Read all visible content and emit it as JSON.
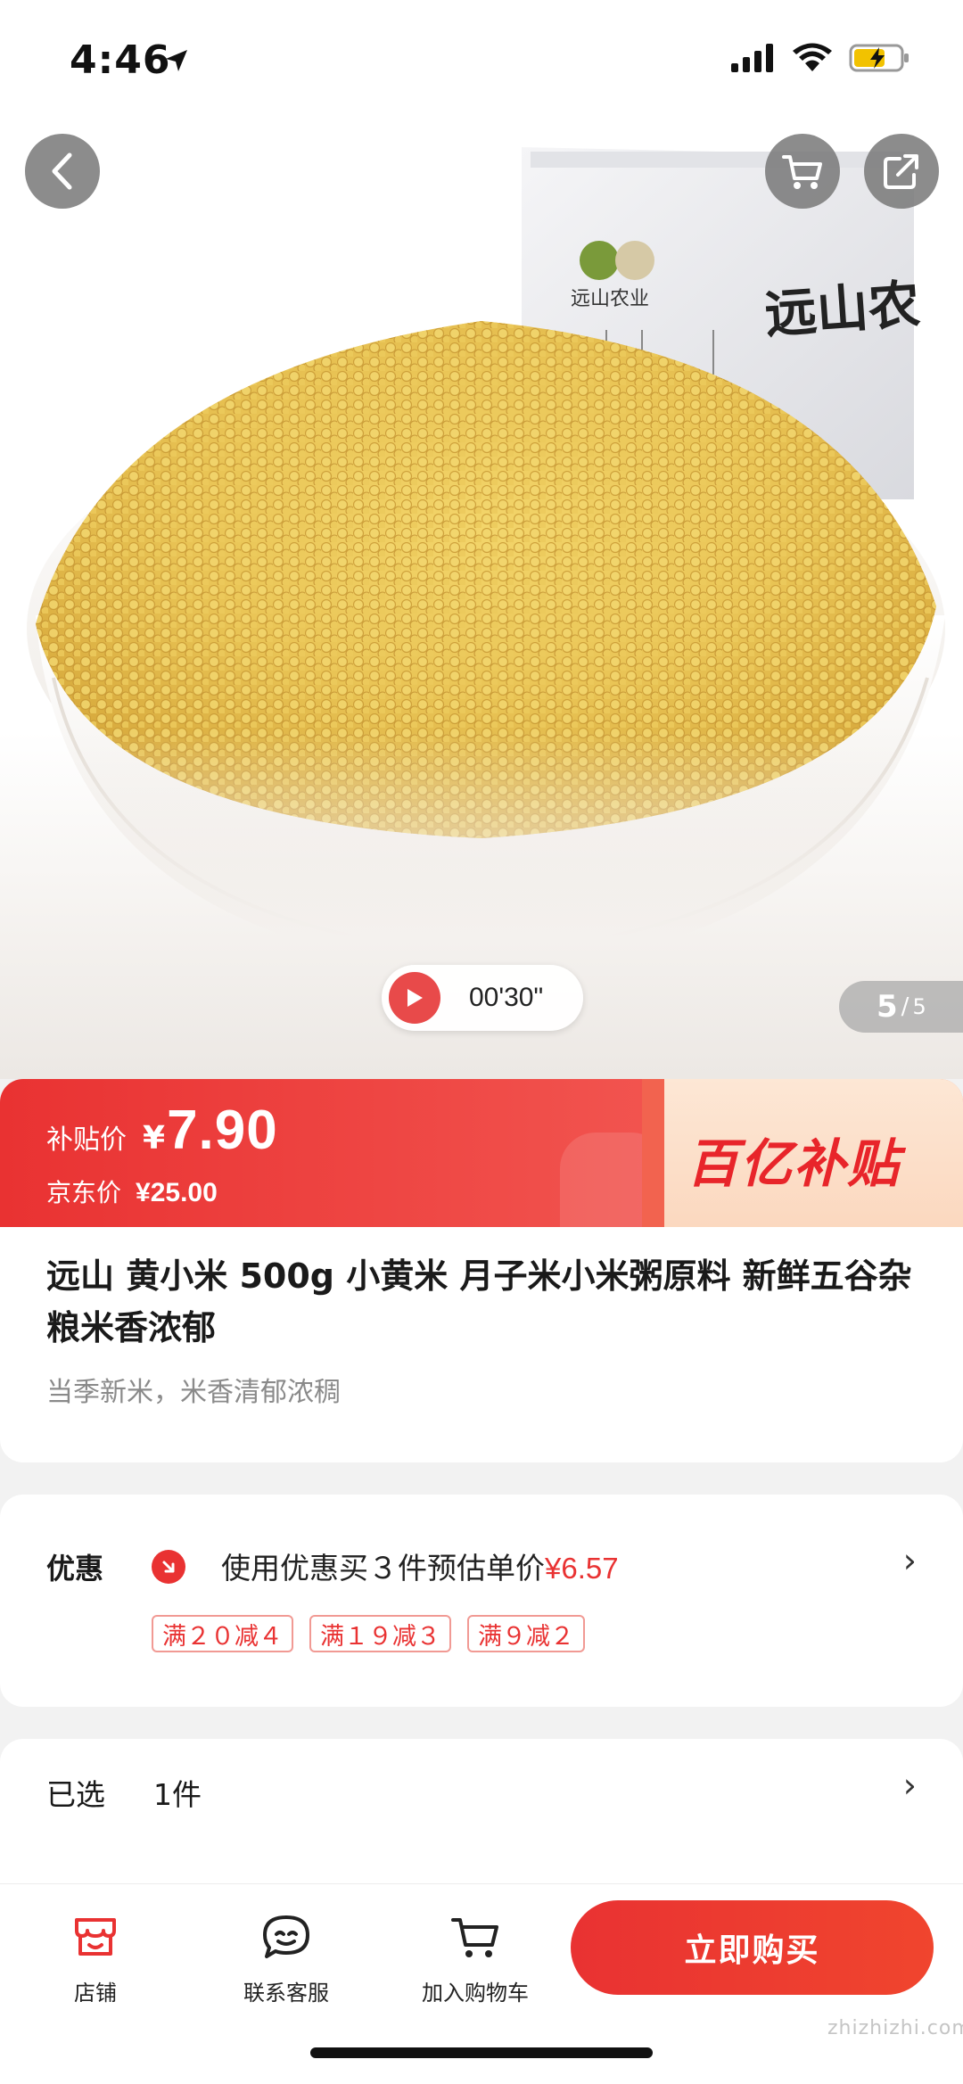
{
  "status_bar": {
    "time": "4:46"
  },
  "hero": {
    "video_duration": "00'30\"",
    "page_current": "5",
    "page_separator": "/",
    "page_total": "5",
    "package_brand": "远山农业",
    "package_name": "远山农"
  },
  "price": {
    "subsidy_label": "补贴价",
    "currency": "¥",
    "subsidy_price": "7.90",
    "original_label": "京东价",
    "original_price": "¥25.00",
    "badge": "百亿补贴"
  },
  "product": {
    "title": "远山 黄小米 500g 小黄米 月子米小米粥原料 新鲜五谷杂粮米香浓郁",
    "subtitle": "当季新米，米香清郁浓稠"
  },
  "promotion": {
    "label": "优惠",
    "text": "使用优惠买３件预估单价",
    "estimated_price": "¥6.57",
    "chevron": "›",
    "coupons": [
      "满２０减４",
      "满１９减３",
      "满９减２"
    ]
  },
  "selection": {
    "label": "已选",
    "value": "1件",
    "chevron": "›"
  },
  "bottom_bar": {
    "store_label": "店铺",
    "service_label": "联系客服",
    "cart_label": "加入购物车",
    "buy_label": "立即购买"
  },
  "watermark": "zhizhizhi.com",
  "colors": {
    "accent_red": "#e93232",
    "coupon_border": "#f19a94",
    "badge_bg": "#fde7d5"
  }
}
